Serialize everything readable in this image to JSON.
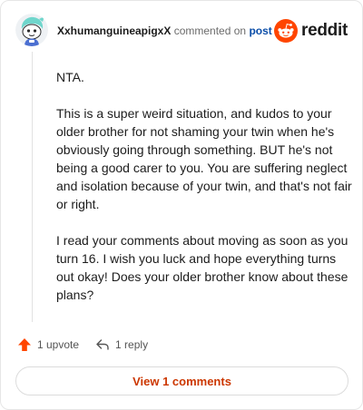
{
  "header": {
    "username": "XxhumanguineapigxX",
    "commented_text": "commented on",
    "post_link": "post",
    "brand": "reddit"
  },
  "comment": {
    "paragraphs": [
      "NTA.",
      "This is a super weird situation, and kudos to your older brother for not shaming your twin when he's obviously going through something. BUT he's not being a good carer to you. You are suffering neglect and isolation because of your twin, and that's not fair or right.",
      "I read your comments about moving as soon as you turn 16. I wish you luck and hope everything turns out okay! Does your older brother know about these plans?"
    ]
  },
  "actions": {
    "upvote_label": "1 upvote",
    "reply_label": "1 reply"
  },
  "footer": {
    "view_comments_label": "View 1 comments"
  },
  "colors": {
    "reddit_orange": "#ff4500",
    "upvote_orange": "#ff4500",
    "link_blue": "#0a4da8",
    "view_button_text": "#cc3700"
  },
  "icons": {
    "avatar": "snoo-avatar-icon",
    "brand": "reddit-snoo-icon",
    "upvote": "upvote-arrow-icon",
    "reply": "reply-arrow-icon"
  }
}
